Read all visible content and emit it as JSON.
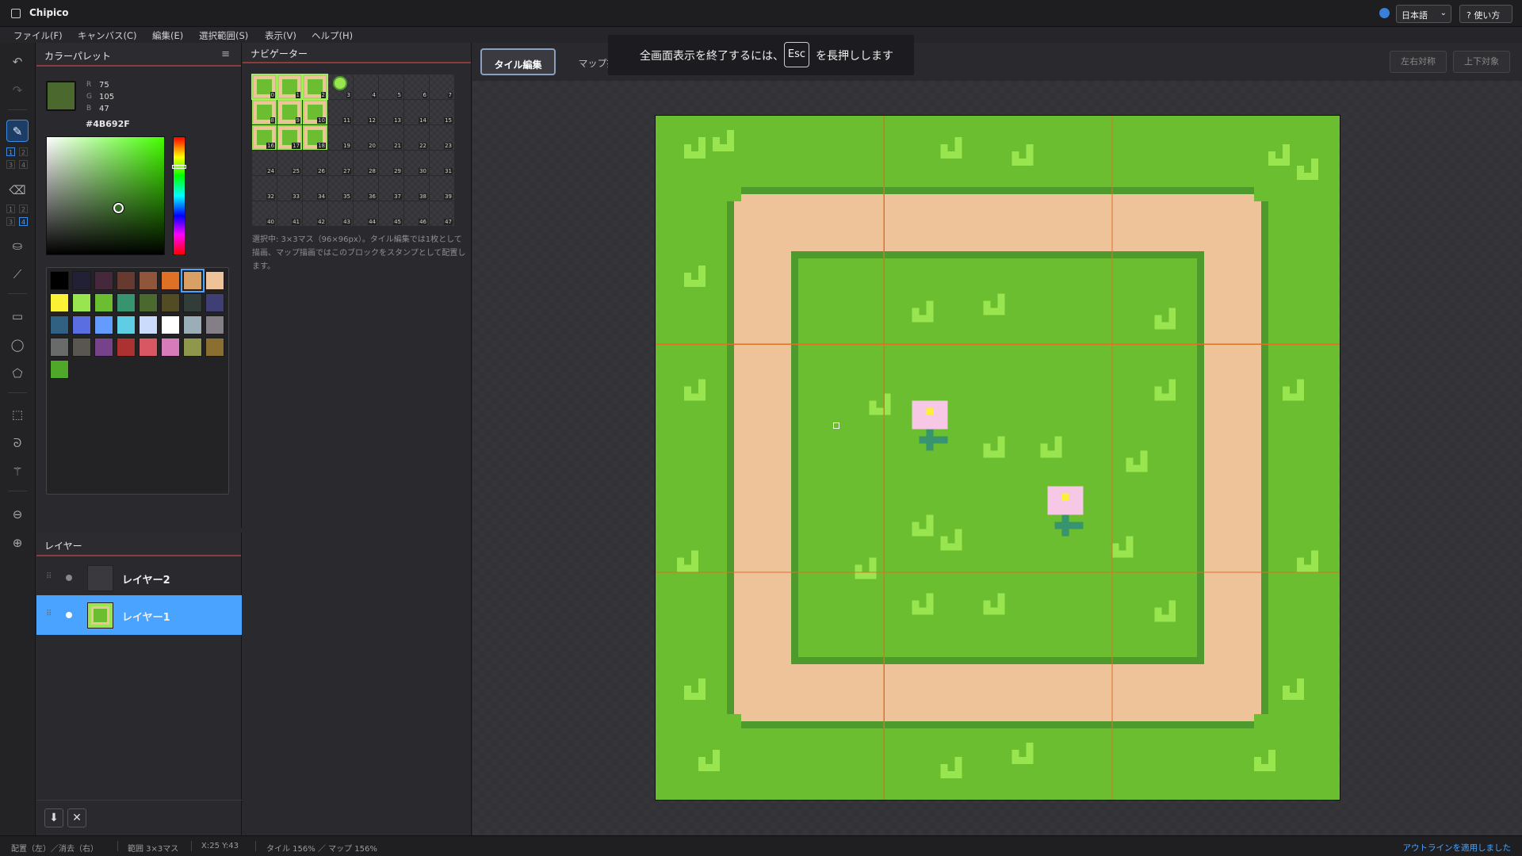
{
  "app": {
    "title": "Chipico"
  },
  "header": {
    "language": "日本語",
    "help": "? 使い方"
  },
  "menu": [
    "ファイル(F)",
    "キャンバス(C)",
    "編集(E)",
    "選択範囲(S)",
    "表示(V)",
    "ヘルプ(H)"
  ],
  "tools": {
    "undo": "undo-icon",
    "redo": "redo-icon",
    "pen": "pen-icon",
    "eraser": "eraser-icon",
    "fill": "bucket-icon",
    "eyedropper": "eyedropper-icon",
    "rect": "rectangle-icon",
    "ellipse": "ellipse-icon",
    "polygon": "polygon-icon",
    "select_rect": "rect-select-icon",
    "lasso": "lasso-icon",
    "magic_wand": "magic-wand-icon",
    "zoom_out": "zoom-out-icon",
    "zoom_in": "zoom-in-icon",
    "pen_sizes": [
      "1",
      "2",
      "3",
      "4"
    ],
    "eraser_sizes": [
      "1",
      "2",
      "3",
      "4"
    ]
  },
  "palette": {
    "title": "カラーパレット",
    "r_label": "R",
    "g_label": "G",
    "b_label": "B",
    "r": "75",
    "g": "105",
    "b": "47",
    "hex": "#4B692F",
    "current_color": "#4B692F",
    "secondary_hex": "#D9A066",
    "swatches": [
      "#000000",
      "#222034",
      "#45283C",
      "#663931",
      "#8F563B",
      "#DF7126",
      "#D9A066",
      "#EEC39A",
      "#FBF236",
      "#99E550",
      "#6ABE30",
      "#37946E",
      "#4B692F",
      "#524B24",
      "#323C39",
      "#3F3F74",
      "#306082",
      "#5B6EE1",
      "#639BFF",
      "#5FCDE4",
      "#CBDBFC",
      "#FFFFFF",
      "#9BADB7",
      "#847E87",
      "#696A6A",
      "#595652",
      "#76428A",
      "#AC3232",
      "#D95763",
      "#D77BBA",
      "#8F974A",
      "#8A6F30",
      "#4FA82A"
    ],
    "add_label": "+",
    "delete_label": "✕"
  },
  "layers": {
    "title": "レイヤー",
    "items": [
      {
        "name": "レイヤー2",
        "selected": false
      },
      {
        "name": "レイヤー1",
        "selected": true
      }
    ]
  },
  "navigator": {
    "title": "ナビゲーター",
    "tile_numbers": [
      "0",
      "1",
      "2",
      "3",
      "4",
      "5",
      "6",
      "7",
      "8",
      "9",
      "10",
      "11",
      "12",
      "13",
      "14",
      "15",
      "16",
      "17",
      "18",
      "19",
      "20",
      "21",
      "22",
      "23",
      "24",
      "25",
      "26",
      "27",
      "28",
      "29",
      "30",
      "31",
      "32",
      "33",
      "34",
      "35",
      "36",
      "37",
      "38",
      "39",
      "40",
      "41",
      "42",
      "43",
      "44",
      "45",
      "46",
      "47"
    ],
    "description": "選択中: 3×3マス（96×96px）。タイル編集では1枚として描画、マップ描画ではこのブロックをスタンプとして配置します。"
  },
  "main": {
    "tab_tile": "タイル編集",
    "tab_map": "マップ描",
    "mirror_h": "左右対称",
    "mirror_v": "上下対象"
  },
  "toast": {
    "before": "全画面表示を終了するには、",
    "key": "Esc",
    "after": "を長押しします"
  },
  "status": {
    "mode": "配置（左）／消去（右）",
    "range": "範囲 3×3マス",
    "coords": "X:25 Y:43",
    "zoom": "タイル 156% ／ マップ 156%",
    "message": "アウトラインを適用しました"
  },
  "colors": {
    "grass": "#6ABE30",
    "grass_light": "#99E550",
    "grass_dark": "#4F9A2C",
    "path": "#EEC39A",
    "guide": "#DF7126",
    "accent": "#4AA3FF"
  }
}
